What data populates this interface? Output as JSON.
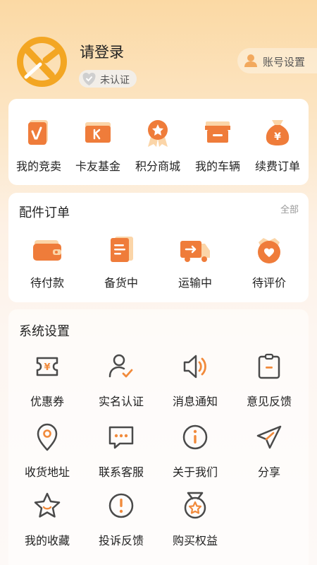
{
  "header": {
    "login_text": "请登录",
    "auth_badge": "未认证",
    "account_button": "账号设置",
    "logo_icon": "brand-logo-icon"
  },
  "quick_menu": {
    "items": [
      {
        "label": "我的竞卖",
        "icon": "auction-icon"
      },
      {
        "label": "卡友基金",
        "icon": "fund-card-icon"
      },
      {
        "label": "积分商城",
        "icon": "medal-icon"
      },
      {
        "label": "我的车辆",
        "icon": "vehicle-shop-icon"
      },
      {
        "label": "续费订单",
        "icon": "money-bag-icon"
      }
    ]
  },
  "orders": {
    "title": "配件订单",
    "all_link": "全部",
    "items": [
      {
        "label": "待付款",
        "icon": "wallet-icon"
      },
      {
        "label": "备货中",
        "icon": "document-icon"
      },
      {
        "label": "运输中",
        "icon": "truck-icon"
      },
      {
        "label": "待评价",
        "icon": "rating-icon"
      }
    ]
  },
  "settings": {
    "title": "系统设置",
    "items": [
      {
        "label": "优惠券",
        "icon": "coupon-icon"
      },
      {
        "label": "实名认证",
        "icon": "user-verify-icon"
      },
      {
        "label": "消息通知",
        "icon": "speaker-icon"
      },
      {
        "label": "意见反馈",
        "icon": "clipboard-icon"
      },
      {
        "label": "收货地址",
        "icon": "location-pin-icon"
      },
      {
        "label": "联系客服",
        "icon": "chat-bubble-icon"
      },
      {
        "label": "关于我们",
        "icon": "info-icon"
      },
      {
        "label": "分享",
        "icon": "share-plane-icon"
      },
      {
        "label": "我的收藏",
        "icon": "star-icon"
      },
      {
        "label": "投诉反馈",
        "icon": "alert-icon"
      },
      {
        "label": "购买权益",
        "icon": "badge-medal-icon"
      }
    ]
  },
  "colors": {
    "accent": "#f18a3b",
    "accent_light": "#fbc98f",
    "icon_gray": "#4a4a4a"
  }
}
